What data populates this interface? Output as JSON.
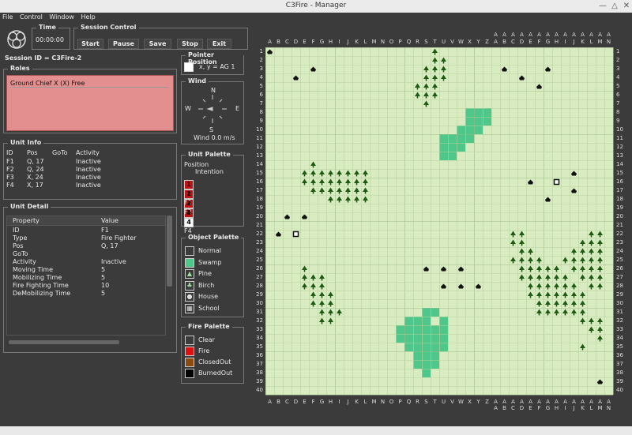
{
  "window": {
    "title": "C3Fire - Manager"
  },
  "menu": [
    "File",
    "Control",
    "Window",
    "Help"
  ],
  "time": {
    "label": "Time",
    "value": "00:00:00"
  },
  "session": {
    "label": "Session Control",
    "buttons": [
      "Start",
      "Pause",
      "Save",
      "Stop",
      "Exit"
    ]
  },
  "session_id": "Session ID = C3Fire-2",
  "roles": {
    "label": "Roles",
    "entry": "Ground Chief X   (X)  Free"
  },
  "pointer": {
    "label": "Pointer Position",
    "readout": "x, y  =  AG 1"
  },
  "wind": {
    "label": "Wind",
    "N": "N",
    "S": "S",
    "E": "E",
    "W": "W",
    "readout": "Wind 0.0 m/s"
  },
  "unit_info": {
    "label": "Unit Info",
    "headers": [
      "ID",
      "Pos",
      "GoTo",
      "Activity"
    ],
    "rows": [
      [
        "F1",
        "Q, 17",
        "",
        "Inactive"
      ],
      [
        "F2",
        "Q, 24",
        "",
        "Inactive"
      ],
      [
        "F3",
        "X, 24",
        "",
        "Inactive"
      ],
      [
        "F4",
        "X, 17",
        "",
        "Inactive"
      ]
    ]
  },
  "unit_detail": {
    "label": "Unit Detail",
    "headers": [
      "Property",
      "Value"
    ],
    "rows": [
      [
        "ID",
        "F1"
      ],
      [
        "Type",
        "Fire Fighter"
      ],
      [
        "Pos",
        "Q, 17"
      ],
      [
        "GoTo",
        ""
      ],
      [
        "Activity",
        "Inactive"
      ],
      [
        "Moving Time",
        "5"
      ],
      [
        "Mobilizing Time",
        "5"
      ],
      [
        "Fire Fighting Time",
        "10"
      ],
      [
        "DeMobilizing Time",
        "5"
      ]
    ]
  },
  "unit_palette": {
    "label": "Unit Palette",
    "pos_label": "Position",
    "intent_label": "Intention",
    "units": [
      {
        "num": "1",
        "name": "F1"
      },
      {
        "num": "2",
        "name": "F2"
      },
      {
        "num": "3",
        "name": "F3"
      },
      {
        "num": "4",
        "name": "F4"
      }
    ]
  },
  "object_palette": {
    "label": "Object Palette",
    "items": [
      {
        "name": "Normal",
        "color": "#3b3b3b",
        "icon": "empty"
      },
      {
        "name": "Swamp",
        "color": "#4fc68a",
        "icon": "swamp"
      },
      {
        "name": "Pine",
        "color": "#3b3b3b",
        "icon": "pine-tree"
      },
      {
        "name": "Birch",
        "color": "#3b3b3b",
        "icon": "birch-tree"
      },
      {
        "name": "House",
        "color": "#3b3b3b",
        "icon": "house"
      },
      {
        "name": "School",
        "color": "#3b3b3b",
        "icon": "school"
      }
    ]
  },
  "fire_palette": {
    "label": "Fire Palette",
    "items": [
      {
        "name": "Clear",
        "color": "#3b3b3b"
      },
      {
        "name": "Fire",
        "color": "#e01010"
      },
      {
        "name": "ClosedOut",
        "color": "#8a4a10"
      },
      {
        "name": "BurnedOut",
        "color": "#000000"
      }
    ]
  },
  "map": {
    "columns": [
      "A",
      "B",
      "C",
      "D",
      "E",
      "F",
      "G",
      "H",
      "I",
      "J",
      "K",
      "L",
      "M",
      "N",
      "O",
      "P",
      "Q",
      "R",
      "S",
      "T",
      "U",
      "V",
      "W",
      "X",
      "Y",
      "Z",
      "AA",
      "AB",
      "AC",
      "AD",
      "AE",
      "AF",
      "AG",
      "AH",
      "AI",
      "AJ",
      "AK",
      "AL",
      "AM",
      "AN"
    ],
    "rows": 40,
    "colors": {
      "grass": "#d9ecc1",
      "grid": "#b7d49f",
      "swamp": "#4fc68a",
      "tree": "#1d5a12",
      "house": "#111111"
    },
    "swamp": [
      [
        23,
        8
      ],
      [
        24,
        8
      ],
      [
        25,
        8
      ],
      [
        23,
        9
      ],
      [
        24,
        9
      ],
      [
        25,
        9
      ],
      [
        22,
        10
      ],
      [
        23,
        10
      ],
      [
        24,
        10
      ],
      [
        21,
        11
      ],
      [
        22,
        11
      ],
      [
        23,
        11
      ],
      [
        21,
        12
      ],
      [
        22,
        12
      ],
      [
        20,
        12
      ],
      [
        20,
        13
      ],
      [
        21,
        13
      ],
      [
        20,
        11
      ],
      [
        16,
        32
      ],
      [
        17,
        32
      ],
      [
        18,
        32
      ],
      [
        15,
        33
      ],
      [
        16,
        33
      ],
      [
        17,
        33
      ],
      [
        18,
        33
      ],
      [
        19,
        33
      ],
      [
        15,
        34
      ],
      [
        16,
        34
      ],
      [
        17,
        34
      ],
      [
        18,
        34
      ],
      [
        19,
        34
      ],
      [
        20,
        34
      ],
      [
        16,
        35
      ],
      [
        17,
        35
      ],
      [
        18,
        35
      ],
      [
        19,
        35
      ],
      [
        20,
        35
      ],
      [
        17,
        36
      ],
      [
        18,
        36
      ],
      [
        19,
        36
      ],
      [
        17,
        37
      ],
      [
        18,
        37
      ],
      [
        19,
        37
      ],
      [
        18,
        38
      ],
      [
        18,
        31
      ],
      [
        19,
        31
      ],
      [
        20,
        32
      ],
      [
        20,
        33
      ]
    ],
    "trees": [
      [
        18,
        3
      ],
      [
        19,
        3
      ],
      [
        20,
        3
      ],
      [
        18,
        4
      ],
      [
        19,
        4
      ],
      [
        20,
        4
      ],
      [
        17,
        5
      ],
      [
        18,
        5
      ],
      [
        19,
        5
      ],
      [
        17,
        6
      ],
      [
        18,
        6
      ],
      [
        19,
        6
      ],
      [
        18,
        7
      ],
      [
        19,
        2
      ],
      [
        20,
        2
      ],
      [
        19,
        1
      ],
      [
        5,
        14
      ],
      [
        4,
        15
      ],
      [
        5,
        15
      ],
      [
        6,
        15
      ],
      [
        7,
        15
      ],
      [
        8,
        15
      ],
      [
        9,
        15
      ],
      [
        10,
        15
      ],
      [
        11,
        15
      ],
      [
        4,
        16
      ],
      [
        5,
        16
      ],
      [
        6,
        16
      ],
      [
        7,
        16
      ],
      [
        8,
        16
      ],
      [
        9,
        16
      ],
      [
        10,
        16
      ],
      [
        11,
        16
      ],
      [
        5,
        17
      ],
      [
        6,
        17
      ],
      [
        7,
        17
      ],
      [
        8,
        17
      ],
      [
        9,
        17
      ],
      [
        10,
        17
      ],
      [
        11,
        17
      ],
      [
        7,
        18
      ],
      [
        8,
        18
      ],
      [
        9,
        18
      ],
      [
        10,
        18
      ],
      [
        11,
        18
      ],
      [
        4,
        26
      ],
      [
        4,
        27
      ],
      [
        5,
        27
      ],
      [
        6,
        27
      ],
      [
        4,
        28
      ],
      [
        5,
        28
      ],
      [
        6,
        28
      ],
      [
        5,
        29
      ],
      [
        6,
        29
      ],
      [
        7,
        29
      ],
      [
        5,
        30
      ],
      [
        6,
        30
      ],
      [
        7,
        30
      ],
      [
        6,
        31
      ],
      [
        7,
        31
      ],
      [
        8,
        31
      ],
      [
        6,
        32
      ],
      [
        7,
        32
      ],
      [
        28,
        22
      ],
      [
        29,
        22
      ],
      [
        28,
        23
      ],
      [
        29,
        23
      ],
      [
        29,
        24
      ],
      [
        30,
        24
      ],
      [
        28,
        25
      ],
      [
        29,
        25
      ],
      [
        30,
        25
      ],
      [
        31,
        25
      ],
      [
        29,
        26
      ],
      [
        30,
        26
      ],
      [
        31,
        26
      ],
      [
        32,
        26
      ],
      [
        33,
        26
      ],
      [
        29,
        27
      ],
      [
        30,
        27
      ],
      [
        31,
        27
      ],
      [
        32,
        27
      ],
      [
        33,
        27
      ],
      [
        34,
        27
      ],
      [
        30,
        28
      ],
      [
        31,
        28
      ],
      [
        32,
        28
      ],
      [
        33,
        28
      ],
      [
        34,
        28
      ],
      [
        35,
        28
      ],
      [
        30,
        29
      ],
      [
        31,
        29
      ],
      [
        32,
        29
      ],
      [
        33,
        29
      ],
      [
        34,
        29
      ],
      [
        35,
        29
      ],
      [
        36,
        29
      ],
      [
        31,
        30
      ],
      [
        32,
        30
      ],
      [
        33,
        30
      ],
      [
        34,
        30
      ],
      [
        35,
        30
      ],
      [
        36,
        30
      ],
      [
        31,
        31
      ],
      [
        32,
        31
      ],
      [
        33,
        31
      ],
      [
        34,
        31
      ],
      [
        35,
        31
      ],
      [
        36,
        31
      ],
      [
        37,
        22
      ],
      [
        38,
        22
      ],
      [
        36,
        23
      ],
      [
        37,
        23
      ],
      [
        38,
        23
      ],
      [
        35,
        24
      ],
      [
        36,
        24
      ],
      [
        37,
        24
      ],
      [
        38,
        24
      ],
      [
        34,
        25
      ],
      [
        35,
        25
      ],
      [
        36,
        25
      ],
      [
        37,
        25
      ],
      [
        38,
        25
      ],
      [
        35,
        26
      ],
      [
        36,
        26
      ],
      [
        37,
        26
      ],
      [
        38,
        26
      ],
      [
        36,
        27
      ],
      [
        37,
        27
      ],
      [
        38,
        27
      ],
      [
        37,
        28
      ],
      [
        38,
        28
      ],
      [
        36,
        32
      ],
      [
        37,
        32
      ],
      [
        38,
        32
      ],
      [
        37,
        33
      ],
      [
        38,
        33
      ],
      [
        38,
        34
      ],
      [
        36,
        35
      ]
    ],
    "houses": [
      [
        0,
        1
      ],
      [
        5,
        3
      ],
      [
        3,
        4
      ],
      [
        27,
        3
      ],
      [
        29,
        4
      ],
      [
        32,
        3
      ],
      [
        31,
        5
      ],
      [
        30,
        16
      ],
      [
        35,
        15
      ],
      [
        32,
        18
      ],
      [
        35,
        17
      ],
      [
        2,
        20
      ],
      [
        4,
        20
      ],
      [
        1,
        22
      ],
      [
        18,
        26
      ],
      [
        20,
        26
      ],
      [
        22,
        26
      ],
      [
        20,
        28
      ],
      [
        22,
        28
      ],
      [
        24,
        28
      ],
      [
        38,
        39
      ]
    ],
    "schools": [
      [
        3,
        22
      ],
      [
        33,
        16
      ]
    ]
  }
}
